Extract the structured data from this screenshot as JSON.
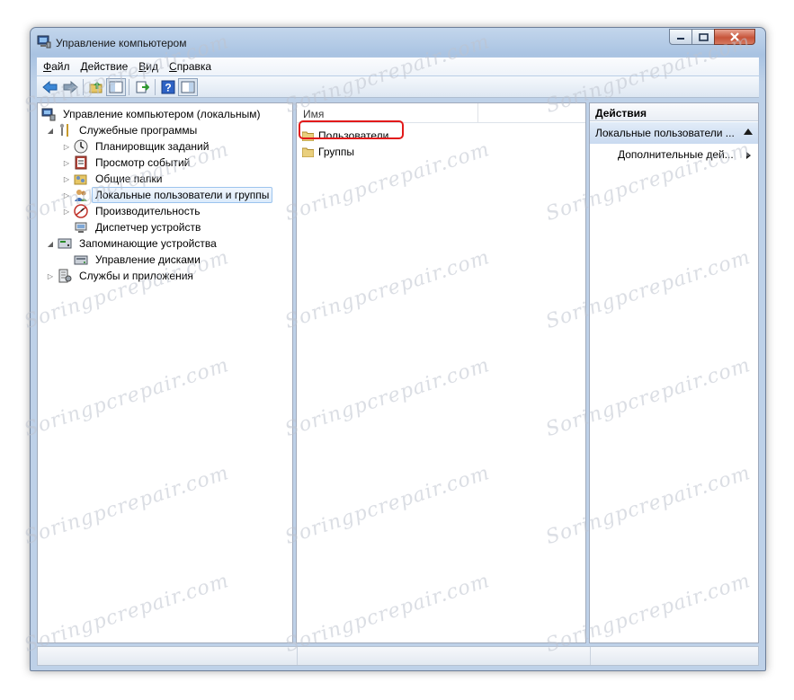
{
  "window": {
    "title": "Управление компьютером"
  },
  "menu": [
    "Файл",
    "Действие",
    "Вид",
    "Справка"
  ],
  "toolbar": [
    "back-icon",
    "forward-icon",
    "up-folder-icon",
    "show-hide-tree-icon",
    "export-list-icon",
    "help-icon",
    "show-hide-action-pane-icon"
  ],
  "tree": {
    "root": "Управление компьютером (локальным)",
    "items": [
      "Служебные программы",
      "Планировщик заданий",
      "Просмотр событий",
      "Общие папки",
      "Локальные пользователи и группы",
      "Производительность",
      "Диспетчер устройств",
      "Запоминающие устройства",
      "Управление дисками",
      "Службы и приложения"
    ]
  },
  "center": {
    "column": "Имя",
    "items": [
      "Пользователи",
      "Группы"
    ]
  },
  "actions": {
    "header": "Действия",
    "section": "Локальные пользователи ...",
    "item": "Дополнительные дей..."
  },
  "watermark": "Soringpcrepair.com",
  "colors": {
    "highlight": "#e21a1a",
    "selection": "#dcebfb"
  }
}
